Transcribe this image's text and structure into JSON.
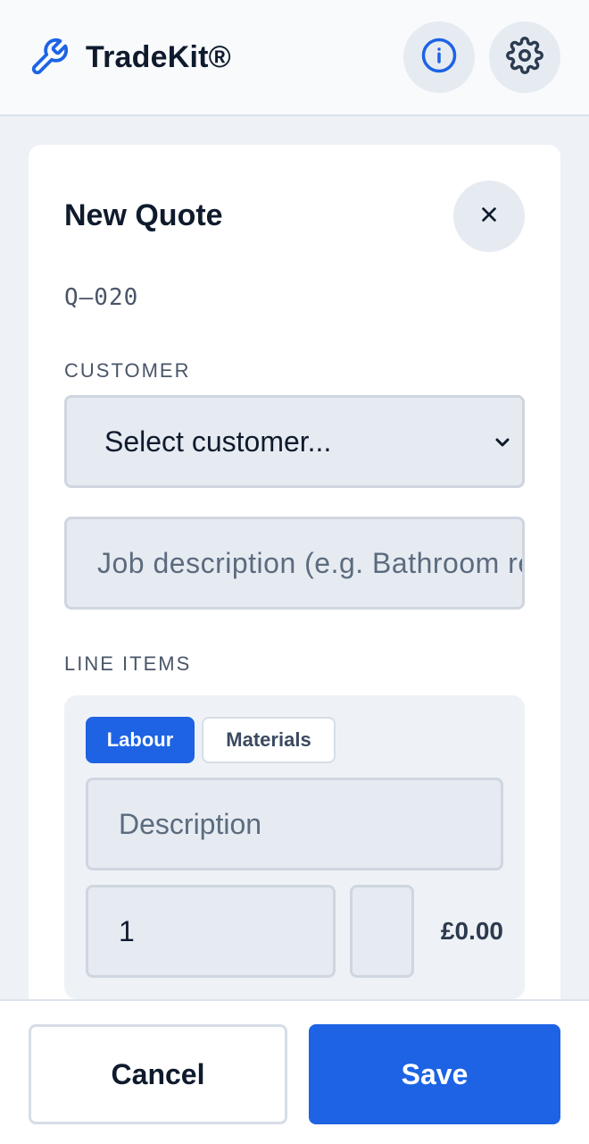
{
  "header": {
    "app_title": "TradeKit®",
    "logo_icon": "wrench-icon",
    "info_icon": "info-icon",
    "settings_icon": "gear-icon"
  },
  "quote": {
    "title": "New Quote",
    "close_icon": "close-icon",
    "quote_number": "Q–020",
    "customer_label": "CUSTOMER",
    "customer_select_value": "Select customer...",
    "job_description_placeholder": "Job description (e.g. Bathroom refit)",
    "line_items_label": "LINE ITEMS",
    "line_item": {
      "tabs": [
        {
          "label": "Labour",
          "active": true
        },
        {
          "label": "Materials",
          "active": false
        }
      ],
      "description_placeholder": "Description",
      "quantity_value": "1",
      "rate_value": "",
      "total": "£0.00"
    }
  },
  "footer": {
    "cancel_label": "Cancel",
    "save_label": "Save"
  },
  "colors": {
    "accent": "#1d63e4",
    "background": "#eef2f6",
    "field_bg": "#e6ebf2"
  }
}
